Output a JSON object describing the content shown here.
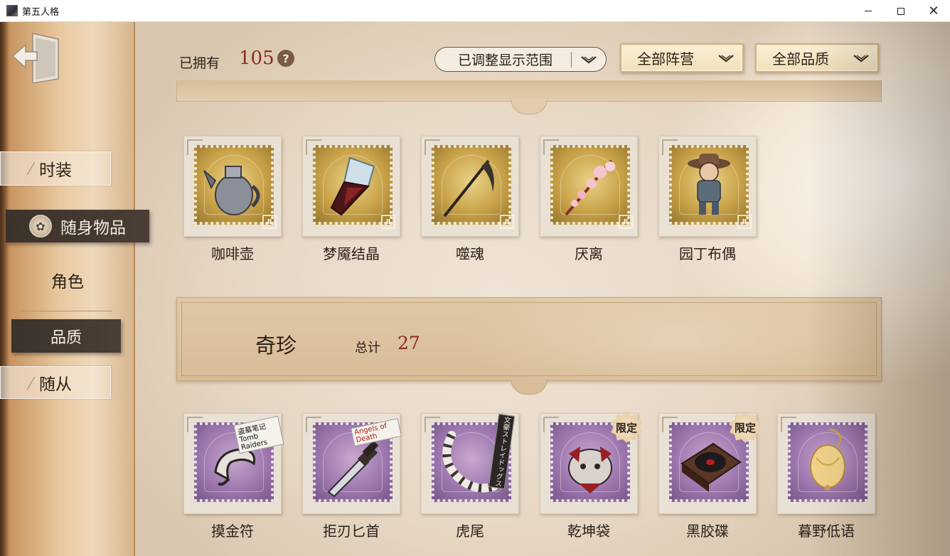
{
  "window": {
    "title": "第五人格",
    "controls": {
      "minimize": "—",
      "maximize": "☐",
      "close": "✕"
    }
  },
  "sidebar": {
    "exit_icon": "exit-door-icon",
    "tabs": [
      {
        "label": "时装",
        "state": "inactive"
      },
      {
        "label": "随身物品",
        "state": "active",
        "icon": "shield-emblem-icon"
      },
      {
        "label": "角色",
        "state": "plain"
      },
      {
        "label": "品质",
        "state": "selected"
      },
      {
        "label": "随从",
        "state": "inactive"
      }
    ]
  },
  "header": {
    "owned_label": "已拥有",
    "owned_count": "105",
    "help_icon": "?",
    "range_select": "已调整显示范围",
    "faction_filter": "全部阵营",
    "quality_filter": "全部品质"
  },
  "sections": {
    "top_row_items": [
      {
        "name": "咖啡壶",
        "rarity": "gold"
      },
      {
        "name": "梦魇结晶",
        "rarity": "gold"
      },
      {
        "name": "噬魂",
        "rarity": "gold"
      },
      {
        "name": "厌离",
        "rarity": "gold"
      },
      {
        "name": "园丁布偶",
        "rarity": "gold"
      }
    ],
    "rare": {
      "title": "奇珍",
      "total_label": "总计",
      "total": "27",
      "items": [
        {
          "name": "摸金符",
          "rarity": "purple",
          "tag": "盗墓笔记 Tomb Raiders"
        },
        {
          "name": "拒刃匕首",
          "rarity": "purple",
          "tag": "Angels of Death"
        },
        {
          "name": "虎尾",
          "rarity": "purple",
          "tag": "文豪ストレイドッグス"
        },
        {
          "name": "乾坤袋",
          "rarity": "purple",
          "badge": "限定"
        },
        {
          "name": "黑胶碟",
          "rarity": "purple",
          "badge": "限定"
        },
        {
          "name": "暮野低语",
          "rarity": "purple"
        }
      ]
    }
  },
  "colors": {
    "accent_red": "#8a2b22",
    "gold_stamp": "#caa44a",
    "purple_stamp": "#a07ab0",
    "active_tab": "#3b322b"
  }
}
